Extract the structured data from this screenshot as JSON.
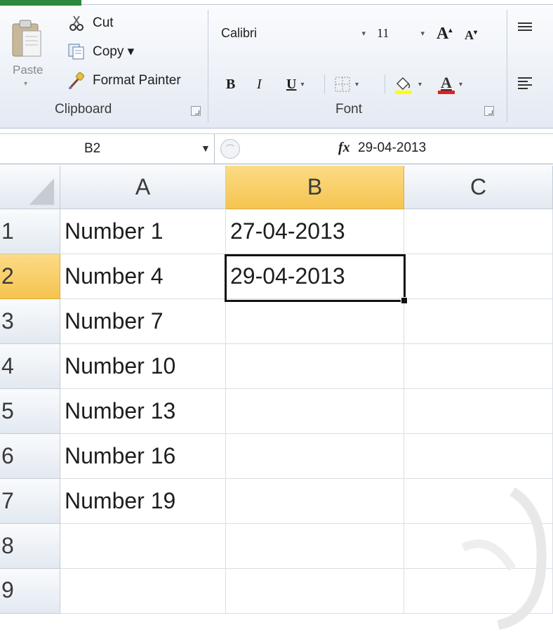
{
  "ribbon": {
    "clipboard": {
      "paste_label": "Paste",
      "cut_label": "Cut",
      "copy_label": "Copy ▾",
      "format_painter_label": "Format Painter",
      "group_label": "Clipboard"
    },
    "font": {
      "font_name": "Calibri",
      "font_size": "11",
      "bold_label": "B",
      "italic_label": "I",
      "underline_label": "U",
      "font_color_label": "A",
      "group_label": "Font",
      "fill_color": "#ffff00",
      "font_color": "#e02020"
    }
  },
  "formula_bar": {
    "name_box": "B2",
    "fx_label": "fx",
    "value": "29-04-2013"
  },
  "sheet": {
    "columns": [
      "A",
      "B",
      "C"
    ],
    "selected_column": "B",
    "selected_row": "2",
    "rows": [
      {
        "num": "1",
        "a": "Number 1",
        "b": "27-04-2013",
        "c": ""
      },
      {
        "num": "2",
        "a": "Number 4",
        "b": "29-04-2013",
        "c": ""
      },
      {
        "num": "3",
        "a": "Number 7",
        "b": "",
        "c": ""
      },
      {
        "num": "4",
        "a": "Number 10",
        "b": "",
        "c": ""
      },
      {
        "num": "5",
        "a": "Number 13",
        "b": "",
        "c": ""
      },
      {
        "num": "6",
        "a": "Number 16",
        "b": "",
        "c": ""
      },
      {
        "num": "7",
        "a": "Number 19",
        "b": "",
        "c": ""
      },
      {
        "num": "8",
        "a": "",
        "b": "",
        "c": ""
      },
      {
        "num": "9",
        "a": "",
        "b": "",
        "c": ""
      }
    ]
  },
  "colors": {
    "selected_header": "#f5c450",
    "grid_line": "#d9dde3"
  }
}
